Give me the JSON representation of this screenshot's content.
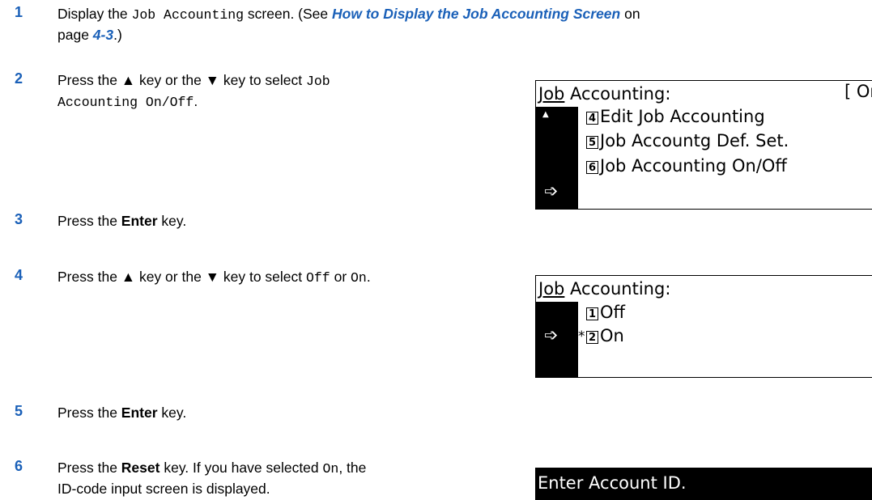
{
  "steps": [
    {
      "num": "1",
      "pre": "Display the ",
      "code": "Job Accounting",
      "mid": " screen. (See ",
      "link": "How to Display the Job Accounting Screen",
      "post": " on",
      "line2a": "page ",
      "page_ref": "4-3",
      "line2b": ".)"
    },
    {
      "num": "2",
      "pre": "Press the ▲ key or the ▼ key to select ",
      "code1": "Job",
      "code2": "Accounting On/Off",
      "post": "."
    },
    {
      "num": "3",
      "pre": "Press the ",
      "bold": "Enter",
      "post": " key."
    },
    {
      "num": "4",
      "pre": "Press the ▲ key or the ▼ key to select ",
      "code1": "Off",
      "mid": " or ",
      "code2": "On",
      "post": "."
    },
    {
      "num": "5",
      "pre": "Press the ",
      "bold": "Enter",
      "post": " key."
    },
    {
      "num": "6",
      "pre": "Press the ",
      "bold": "Reset",
      "mid": " key. If you have selected ",
      "code": "On",
      "post": ", the",
      "line2": "ID-code input screen is displayed."
    }
  ],
  "lcd1": {
    "title_u": "Job",
    "title_rest": " Accounting:",
    "state": "[ On",
    "items": [
      {
        "key": "4",
        "label": "Edit Job Accounting"
      },
      {
        "key": "5",
        "label": "Job Accountg Def. Set."
      },
      {
        "key": "6",
        "label": "Job Accounting On/Off"
      }
    ],
    "arrow": "➩",
    "scroll": "▲"
  },
  "lcd2": {
    "title_u": "Job",
    "title_rest": " Accounting:",
    "items": [
      {
        "key": "1",
        "label": "Off"
      },
      {
        "key": "2",
        "label": "On"
      }
    ],
    "star": "*",
    "arrow": "➩"
  },
  "lcd3": {
    "title": "Enter Account ID."
  }
}
